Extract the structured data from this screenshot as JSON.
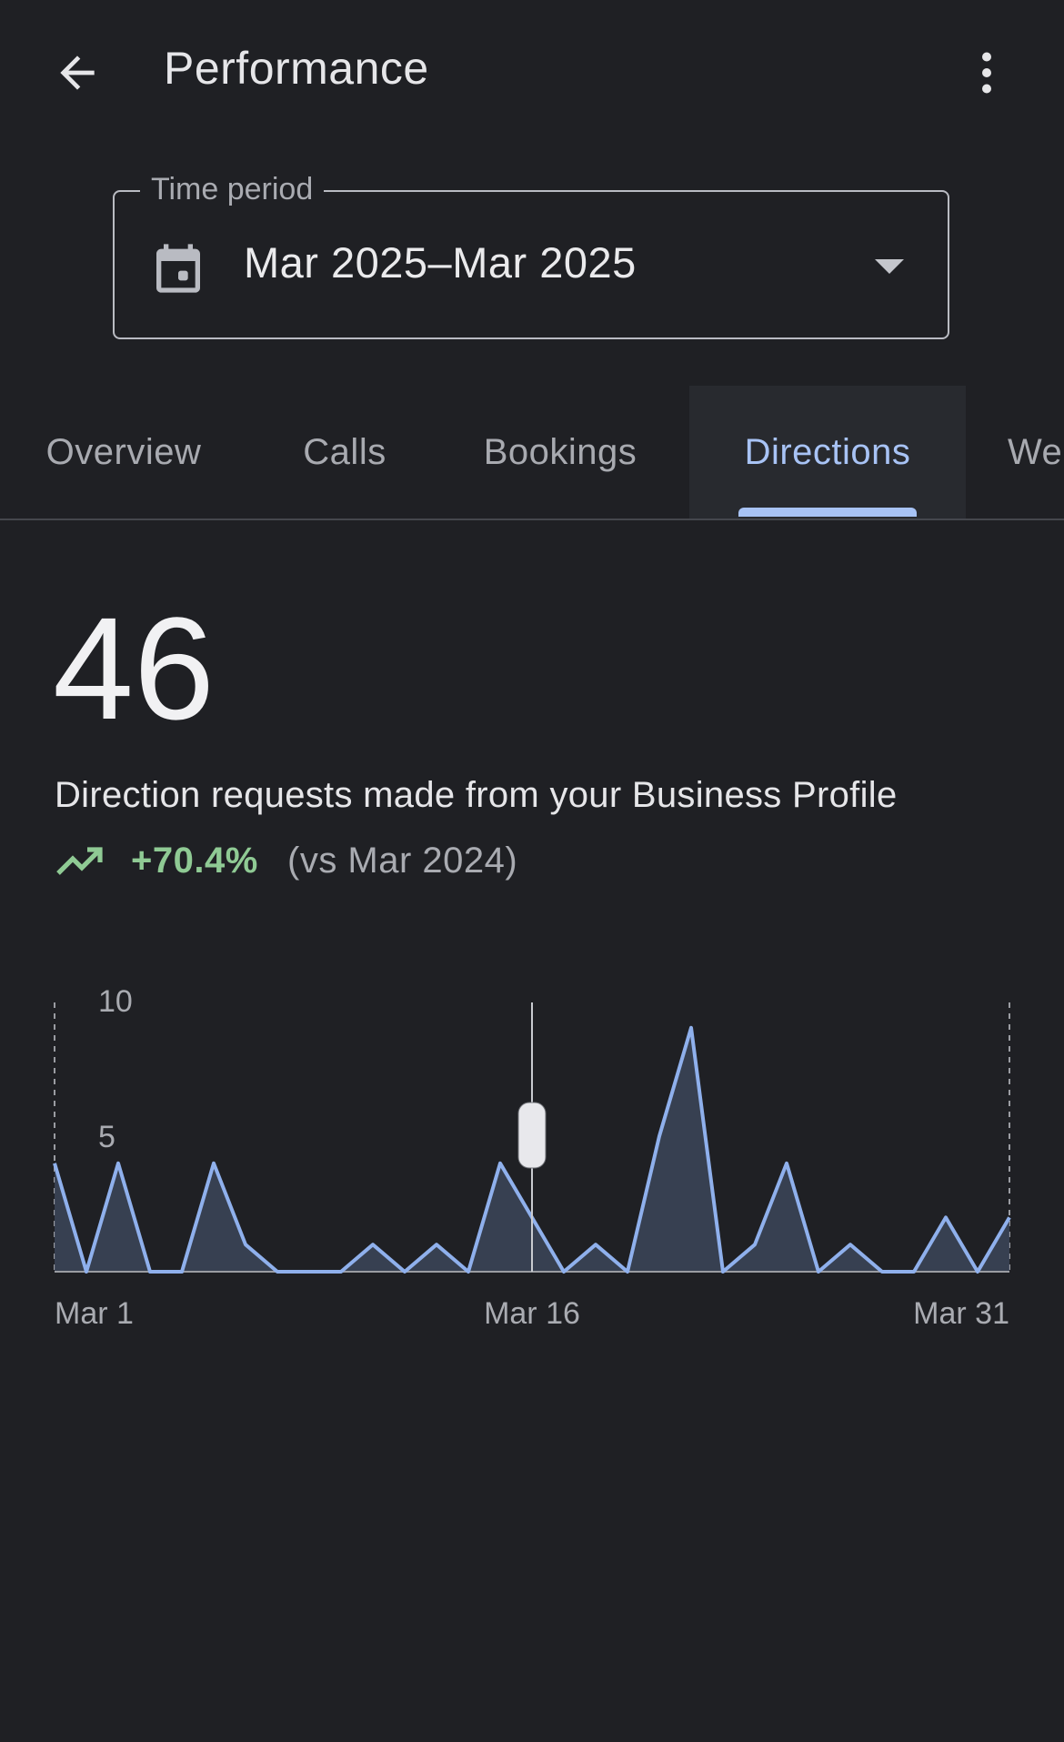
{
  "app": {
    "title": "Performance"
  },
  "icons": {
    "back": "arrow-back-icon",
    "more": "more-vert-icon",
    "calendar": "calendar-icon",
    "dropdown": "arrow-drop-down-icon",
    "trend": "trending-up-icon"
  },
  "period": {
    "legend": "Time period",
    "value": "Mar 2025–Mar 2025"
  },
  "tabs": [
    {
      "label": "Overview",
      "active": false
    },
    {
      "label": "Calls",
      "active": false
    },
    {
      "label": "Bookings",
      "active": false
    },
    {
      "label": "Directions",
      "active": true
    },
    {
      "label": "Website clicks",
      "active": false
    }
  ],
  "metric": {
    "value": "46",
    "description": "Direction requests made from your Business Profile",
    "change": "+70.4%",
    "comparison": "(vs Mar 2024)"
  },
  "colors": {
    "background": "#1f2024",
    "accent": "#a8c3f5",
    "line": "#8fb0ec",
    "area": "#3a4457",
    "positive": "#8fca94"
  },
  "chart_data": {
    "type": "area",
    "x": [
      "Mar 1",
      "Mar 2",
      "Mar 3",
      "Mar 4",
      "Mar 5",
      "Mar 6",
      "Mar 7",
      "Mar 8",
      "Mar 9",
      "Mar 10",
      "Mar 11",
      "Mar 12",
      "Mar 13",
      "Mar 14",
      "Mar 15",
      "Mar 16",
      "Mar 17",
      "Mar 18",
      "Mar 19",
      "Mar 20",
      "Mar 21",
      "Mar 22",
      "Mar 23",
      "Mar 24",
      "Mar 25",
      "Mar 26",
      "Mar 27",
      "Mar 28",
      "Mar 29",
      "Mar 30",
      "Mar 31"
    ],
    "values": [
      4,
      0,
      4,
      0,
      0,
      4,
      1,
      0,
      0,
      0,
      1,
      0,
      1,
      0,
      4,
      2,
      0,
      1,
      0,
      5,
      9,
      0,
      1,
      4,
      0,
      1,
      0,
      0,
      2,
      0,
      2
    ],
    "xticks": [
      "Mar 1",
      "Mar 16",
      "Mar 31"
    ],
    "yticks": [
      5,
      10
    ],
    "ylim": [
      0,
      10
    ],
    "cursor_x": "Mar 16"
  }
}
